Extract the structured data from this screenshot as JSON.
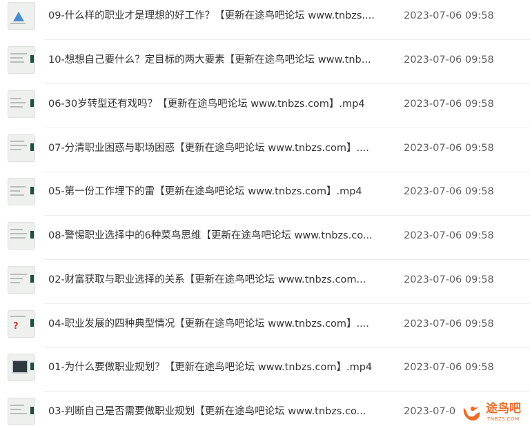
{
  "files": [
    {
      "name": "09-什么样的职业才是理想的好工作？【更新在途鸟吧论坛 www.tnbzs....",
      "date": "2023-07-06 09:58",
      "thumb_icon": "pyramid-diagram-thumbnail"
    },
    {
      "name": "10-想想自己要什么？定目标的两大要素【更新在途鸟吧论坛 www.tnb...",
      "date": "2023-07-06 09:58",
      "thumb_icon": "slide-thumbnail"
    },
    {
      "name": "06-30岁转型还有戏吗？【更新在途鸟吧论坛 www.tnbzs.com】.mp4",
      "date": "2023-07-06 09:58",
      "thumb_icon": "slide-thumbnail"
    },
    {
      "name": "07-分清职业困惑与职场困惑【更新在途鸟吧论坛 www.tnbzs.com】....",
      "date": "2023-07-06 09:58",
      "thumb_icon": "slide-thumbnail"
    },
    {
      "name": "05-第一份工作埋下的雷【更新在途鸟吧论坛 www.tnbzs.com】.mp4",
      "date": "2023-07-06 09:58",
      "thumb_icon": "slide-thumbnail"
    },
    {
      "name": "08-警惕职业选择中的6种菜鸟思维【更新在途鸟吧论坛 www.tnbzs.co...",
      "date": "2023-07-06 09:58",
      "thumb_icon": "slide-thumbnail"
    },
    {
      "name": "02-财富获取与职业选择的关系【更新在途鸟吧论坛 www.tnbzs.com...",
      "date": "2023-07-06 09:58",
      "thumb_icon": "slide-thumbnail"
    },
    {
      "name": "04-职业发展的四种典型情况【更新在途鸟吧论坛 www.tnbzs.com】....",
      "date": "2023-07-06 09:58",
      "thumb_icon": "question-mark-thumbnail"
    },
    {
      "name": "01-为什么要做职业规划？【更新在途鸟吧论坛 www.tnbzs.com】.mp4",
      "date": "2023-07-06 09:58",
      "thumb_icon": "card-thumbnail"
    },
    {
      "name": "03-判断自己是否需要做职业规划【更新在途鸟吧论坛 www.tnbzs.co...",
      "date": "2023-07-0",
      "thumb_icon": "slide-thumbnail"
    }
  ],
  "watermark": {
    "text": "途鸟吧",
    "subtext": "TNBZS.COM",
    "color": "#ee6b27"
  }
}
